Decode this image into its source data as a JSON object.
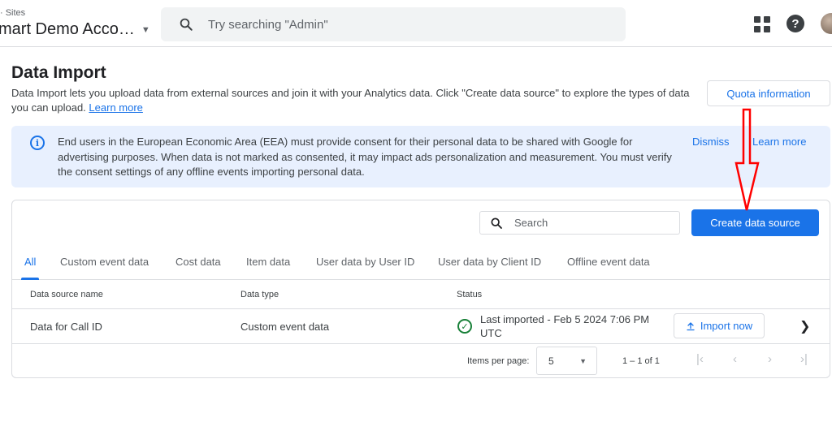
{
  "header": {
    "breadcrumb": "· Sites",
    "account_name": "mart Demo Acco…",
    "search_placeholder": "Try searching \"Admin\""
  },
  "page": {
    "title": "Data Import",
    "description": "Data Import lets you upload data from external sources and join it with your Analytics data. Click \"Create data source\" to explore the types of data you can upload.",
    "learn_more": "Learn more",
    "quota_button": "Quota information"
  },
  "banner": {
    "text": "End users in the European Economic Area (EEA) must provide consent for their personal data to be shared with Google for advertising purposes. When data is not marked as consented, it may impact ads personalization and measurement. You must verify the consent settings of any offline events importing personal data.",
    "dismiss": "Dismiss",
    "learn_more": "Learn more"
  },
  "toolbar": {
    "search_placeholder": "Search",
    "create_button": "Create data source"
  },
  "tabs": [
    "All",
    "Custom event data",
    "Cost data",
    "Item data",
    "User data by User ID",
    "User data by Client ID",
    "Offline event data"
  ],
  "table": {
    "columns": [
      "Data source name",
      "Data type",
      "Status"
    ],
    "rows": [
      {
        "name": "Data for Call ID",
        "type": "Custom event data",
        "status": "Last imported - Feb 5 2024 7:06 PM UTC",
        "action": "Import now"
      }
    ]
  },
  "pagination": {
    "items_label": "Items per page:",
    "items_value": "5",
    "range": "1 – 1 of 1"
  },
  "colors": {
    "accent": "#1a73e8",
    "banner_bg": "#e8f0fe",
    "success": "#188038",
    "annotation": "#ff0000"
  }
}
